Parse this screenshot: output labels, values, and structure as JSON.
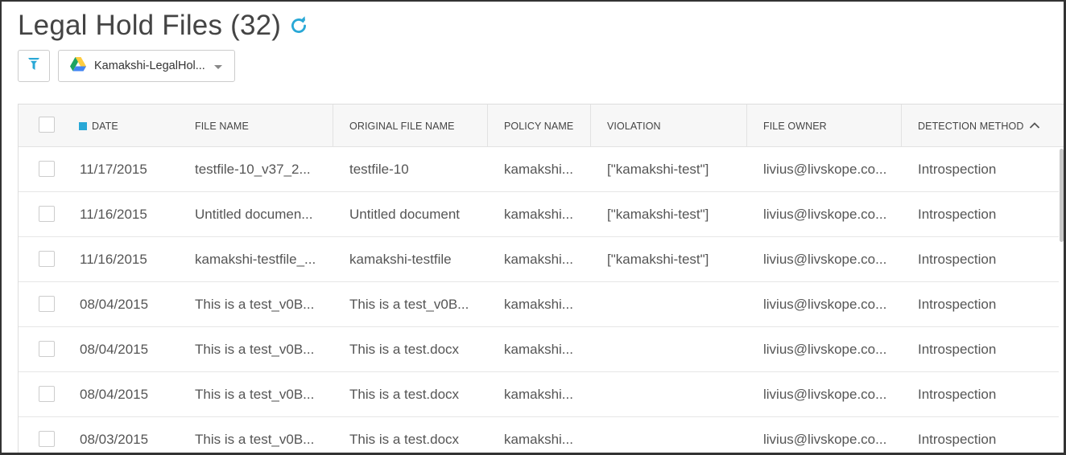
{
  "page": {
    "title": "Legal Hold Files (32)"
  },
  "toolbar": {
    "app_selector_label": "Kamakshi-LegalHol..."
  },
  "table": {
    "columns": [
      "DATE",
      "FILE NAME",
      "ORIGINAL FILE NAME",
      "POLICY NAME",
      "VIOLATION",
      "FILE OWNER",
      "DETECTION METHOD"
    ],
    "rows": [
      {
        "date": "11/17/2015",
        "file_name": "testfile-10_v37_2...",
        "original_file_name": "testfile-10",
        "policy_name": "kamakshi...",
        "violation": "[\"kamakshi-test\"]",
        "file_owner": "livius@livskope.co...",
        "detection_method": "Introspection"
      },
      {
        "date": "11/16/2015",
        "file_name": "Untitled documen...",
        "original_file_name": "Untitled document",
        "policy_name": "kamakshi...",
        "violation": "[\"kamakshi-test\"]",
        "file_owner": "livius@livskope.co...",
        "detection_method": "Introspection"
      },
      {
        "date": "11/16/2015",
        "file_name": "kamakshi-testfile_...",
        "original_file_name": "kamakshi-testfile",
        "policy_name": "kamakshi...",
        "violation": "[\"kamakshi-test\"]",
        "file_owner": "livius@livskope.co...",
        "detection_method": "Introspection"
      },
      {
        "date": "08/04/2015",
        "file_name": "This is a test_v0B...",
        "original_file_name": "This is a test_v0B...",
        "policy_name": "kamakshi...",
        "violation": "",
        "file_owner": "livius@livskope.co...",
        "detection_method": "Introspection"
      },
      {
        "date": "08/04/2015",
        "file_name": "This is a test_v0B...",
        "original_file_name": "This is a test.docx",
        "policy_name": "kamakshi...",
        "violation": "",
        "file_owner": "livius@livskope.co...",
        "detection_method": "Introspection"
      },
      {
        "date": "08/04/2015",
        "file_name": "This is a test_v0B...",
        "original_file_name": "This is a test.docx",
        "policy_name": "kamakshi...",
        "violation": "",
        "file_owner": "livius@livskope.co...",
        "detection_method": "Introspection"
      },
      {
        "date": "08/03/2015",
        "file_name": "This is a test_v0B...",
        "original_file_name": "This is a test.docx",
        "policy_name": "kamakshi...",
        "violation": "",
        "file_owner": "livius@livskope.co...",
        "detection_method": "Introspection"
      }
    ]
  },
  "icons": {
    "refresh": "refresh-icon",
    "filter": "filter-icon",
    "app": "google-drive-icon",
    "collapse": "chevron-up-icon"
  },
  "colors": {
    "accent": "#29a8d6",
    "drive_green": "#1ea362",
    "drive_yellow": "#ffcd40",
    "drive_blue": "#4285f4"
  }
}
